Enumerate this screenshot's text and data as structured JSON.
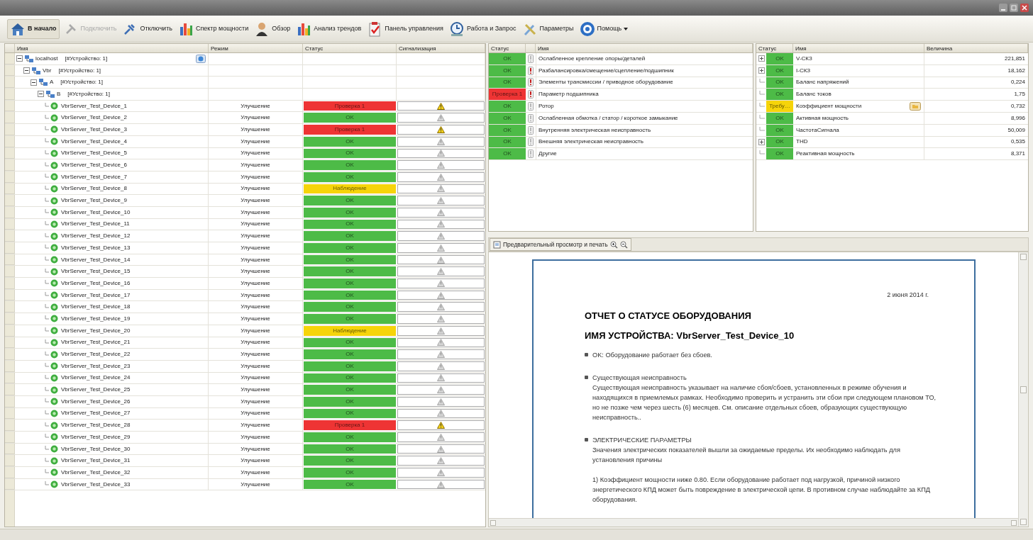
{
  "toolbar": [
    {
      "label": "В начало",
      "disabled": false,
      "kind": "button",
      "bold": true
    },
    {
      "label": "Подключить",
      "disabled": true,
      "kind": "button",
      "bold": false
    },
    {
      "label": "Отключить",
      "disabled": false,
      "kind": "button",
      "bold": false
    },
    {
      "label": "Спектр мощности",
      "disabled": false,
      "kind": "button",
      "bold": false
    },
    {
      "label": "Обзор",
      "disabled": false,
      "kind": "button",
      "bold": false
    },
    {
      "label": "Анализ трендов",
      "disabled": false,
      "kind": "button",
      "bold": false
    },
    {
      "label": "Панель управления",
      "disabled": false,
      "kind": "button",
      "bold": false
    },
    {
      "label": "Работа и Запрос",
      "disabled": false,
      "kind": "button",
      "bold": false
    },
    {
      "label": "Параметры",
      "disabled": false,
      "kind": "button",
      "bold": false
    },
    {
      "label": "Помощь",
      "disabled": false,
      "kind": "menu",
      "bold": false
    }
  ],
  "device_tree": {
    "columns": [
      "Имя",
      "Режим",
      "Статус",
      "Сигнализация"
    ],
    "nodes": [
      {
        "name": "localhost",
        "count": "[#Устройство: 1]",
        "expanded": true,
        "children": [
          {
            "name": "Vbr",
            "count": "[#Устройство: 1]",
            "expanded": true,
            "children": [
              {
                "name": "A",
                "count": "[#Устройство: 1]",
                "expanded": true,
                "children": [
                  {
                    "name": "B",
                    "count": "[#Устройство: 1]",
                    "expanded": true,
                    "children": [
                      {
                        "name": "VbrServer_Test_Device_1",
                        "mode": "Улучшение",
                        "status": "Проверка 1",
                        "color": "#ee3434",
                        "alarm": true
                      },
                      {
                        "name": "VbrServer_Test_Device_2",
                        "mode": "Улучшение",
                        "status": "OK",
                        "color": "#4dbb47",
                        "alarm": false
                      },
                      {
                        "name": "VbrServer_Test_Device_3",
                        "mode": "Улучшение",
                        "status": "Проверка 1",
                        "color": "#ee3434",
                        "alarm": true
                      },
                      {
                        "name": "VbrServer_Test_Device_4",
                        "mode": "Улучшение",
                        "status": "OK",
                        "color": "#4dbb47",
                        "alarm": false
                      },
                      {
                        "name": "VbrServer_Test_Device_5",
                        "mode": "Улучшение",
                        "status": "OK",
                        "color": "#4dbb47",
                        "alarm": false
                      },
                      {
                        "name": "VbrServer_Test_Device_6",
                        "mode": "Улучшение",
                        "status": "OK",
                        "color": "#4dbb47",
                        "alarm": false
                      },
                      {
                        "name": "VbrServer_Test_Device_7",
                        "mode": "Улучшение",
                        "status": "OK",
                        "color": "#4dbb47",
                        "alarm": false
                      },
                      {
                        "name": "VbrServer_Test_Device_8",
                        "mode": "Улучшение",
                        "status": "Наблюдение",
                        "color": "#f6d40a",
                        "alarm": false
                      },
                      {
                        "name": "VbrServer_Test_Device_9",
                        "mode": "Улучшение",
                        "status": "OK",
                        "color": "#4dbb47",
                        "alarm": false
                      },
                      {
                        "name": "VbrServer_Test_Device_10",
                        "mode": "Улучшение",
                        "status": "OK",
                        "color": "#4dbb47",
                        "alarm": false
                      },
                      {
                        "name": "VbrServer_Test_Device_11",
                        "mode": "Улучшение",
                        "status": "OK",
                        "color": "#4dbb47",
                        "alarm": false
                      },
                      {
                        "name": "VbrServer_Test_Device_12",
                        "mode": "Улучшение",
                        "status": "OK",
                        "color": "#4dbb47",
                        "alarm": false
                      },
                      {
                        "name": "VbrServer_Test_Device_13",
                        "mode": "Улучшение",
                        "status": "OK",
                        "color": "#4dbb47",
                        "alarm": false
                      },
                      {
                        "name": "VbrServer_Test_Device_14",
                        "mode": "Улучшение",
                        "status": "OK",
                        "color": "#4dbb47",
                        "alarm": false
                      },
                      {
                        "name": "VbrServer_Test_Device_15",
                        "mode": "Улучшение",
                        "status": "OK",
                        "color": "#4dbb47",
                        "alarm": false
                      },
                      {
                        "name": "VbrServer_Test_Device_16",
                        "mode": "Улучшение",
                        "status": "OK",
                        "color": "#4dbb47",
                        "alarm": false
                      },
                      {
                        "name": "VbrServer_Test_Device_17",
                        "mode": "Улучшение",
                        "status": "OK",
                        "color": "#4dbb47",
                        "alarm": false
                      },
                      {
                        "name": "VbrServer_Test_Device_18",
                        "mode": "Улучшение",
                        "status": "OK",
                        "color": "#4dbb47",
                        "alarm": false
                      },
                      {
                        "name": "VbrServer_Test_Device_19",
                        "mode": "Улучшение",
                        "status": "OK",
                        "color": "#4dbb47",
                        "alarm": false
                      },
                      {
                        "name": "VbrServer_Test_Device_20",
                        "mode": "Улучшение",
                        "status": "Наблюдение",
                        "color": "#f6d40a",
                        "alarm": false
                      },
                      {
                        "name": "VbrServer_Test_Device_21",
                        "mode": "Улучшение",
                        "status": "OK",
                        "color": "#4dbb47",
                        "alarm": false
                      },
                      {
                        "name": "VbrServer_Test_Device_22",
                        "mode": "Улучшение",
                        "status": "OK",
                        "color": "#4dbb47",
                        "alarm": false
                      },
                      {
                        "name": "VbrServer_Test_Device_23",
                        "mode": "Улучшение",
                        "status": "OK",
                        "color": "#4dbb47",
                        "alarm": false
                      },
                      {
                        "name": "VbrServer_Test_Device_24",
                        "mode": "Улучшение",
                        "status": "OK",
                        "color": "#4dbb47",
                        "alarm": false
                      },
                      {
                        "name": "VbrServer_Test_Device_25",
                        "mode": "Улучшение",
                        "status": "OK",
                        "color": "#4dbb47",
                        "alarm": false
                      },
                      {
                        "name": "VbrServer_Test_Device_26",
                        "mode": "Улучшение",
                        "status": "OK",
                        "color": "#4dbb47",
                        "alarm": false
                      },
                      {
                        "name": "VbrServer_Test_Device_27",
                        "mode": "Улучшение",
                        "status": "OK",
                        "color": "#4dbb47",
                        "alarm": false
                      },
                      {
                        "name": "VbrServer_Test_Device_28",
                        "mode": "Улучшение",
                        "status": "Проверка 1",
                        "color": "#ee3434",
                        "alarm": true
                      },
                      {
                        "name": "VbrServer_Test_Device_29",
                        "mode": "Улучшение",
                        "status": "OK",
                        "color": "#4dbb47",
                        "alarm": false
                      },
                      {
                        "name": "VbrServer_Test_Device_30",
                        "mode": "Улучшение",
                        "status": "OK",
                        "color": "#4dbb47",
                        "alarm": false
                      },
                      {
                        "name": "VbrServer_Test_Device_31",
                        "mode": "Улучшение",
                        "status": "OK",
                        "color": "#4dbb47",
                        "alarm": false
                      },
                      {
                        "name": "VbrServer_Test_Device_32",
                        "mode": "Улучшение",
                        "status": "OK",
                        "color": "#4dbb47",
                        "alarm": false
                      },
                      {
                        "name": "VbrServer_Test_Device_33",
                        "mode": "Улучшение",
                        "status": "OK",
                        "color": "#4dbb47",
                        "alarm": false
                      }
                    ]
                  }
                ]
              }
            ]
          }
        ]
      }
    ]
  },
  "fault_table": {
    "columns": [
      "Статус",
      "Имя"
    ],
    "rows": [
      {
        "status": "OK",
        "color": "#4dbb47",
        "severe": false,
        "name": "Ослабленное крепление опоры/деталей"
      },
      {
        "status": "OK",
        "color": "#4dbb47",
        "severe": true,
        "name": "Разбалансировка/смещение/сцепление/подшипник"
      },
      {
        "status": "OK",
        "color": "#4dbb47",
        "severe": true,
        "name": "Элементы трансмиссии / приводное оборудование"
      },
      {
        "status": "Проверка 1",
        "color": "#ee3434",
        "severe": true,
        "name": "Параметр подшипника"
      },
      {
        "status": "OK",
        "color": "#4dbb47",
        "severe": false,
        "name": "Ротор"
      },
      {
        "status": "OK",
        "color": "#4dbb47",
        "severe": false,
        "name": "Ослабленная обмотка / статор / короткое замыкание"
      },
      {
        "status": "OK",
        "color": "#4dbb47",
        "severe": false,
        "name": "Внутренняя электрическая неисправность"
      },
      {
        "status": "OK",
        "color": "#4dbb47",
        "severe": false,
        "name": "Внешняя электрическая неисправность"
      },
      {
        "status": "OK",
        "color": "#4dbb47",
        "severe": false,
        "name": "Другие"
      }
    ]
  },
  "parameter_table": {
    "columns": [
      "Статус",
      "Имя",
      "Величина"
    ],
    "rows": [
      {
        "status": "OK",
        "color": "#4dbb47",
        "name": "V-СКЗ",
        "value": "221,851",
        "expandable": true,
        "attachment": false
      },
      {
        "status": "OK",
        "color": "#4dbb47",
        "name": "I-СКЗ",
        "value": "18,162",
        "expandable": true,
        "attachment": false
      },
      {
        "status": "OK",
        "color": "#4dbb47",
        "name": "Баланс напряжений",
        "value": "0,224",
        "expandable": false,
        "attachment": false
      },
      {
        "status": "OK",
        "color": "#4dbb47",
        "name": "Баланс токов",
        "value": "1,75",
        "expandable": false,
        "attachment": false
      },
      {
        "status": "Требу…",
        "color": "#f6d40a",
        "name": "Коэффициент мощности",
        "value": "0,732",
        "expandable": false,
        "attachment": true
      },
      {
        "status": "OK",
        "color": "#4dbb47",
        "name": "Активная мощность",
        "value": "8,996",
        "expandable": false,
        "attachment": false
      },
      {
        "status": "OK",
        "color": "#4dbb47",
        "name": "ЧастотаСигнала",
        "value": "50,009",
        "expandable": false,
        "attachment": false
      },
      {
        "status": "OK",
        "color": "#4dbb47",
        "name": "THD",
        "value": "0,535",
        "expandable": true,
        "attachment": false
      },
      {
        "status": "OK",
        "color": "#4dbb47",
        "name": "Реактивная мощность",
        "value": "8,371",
        "expandable": false,
        "attachment": false
      }
    ]
  },
  "preview": {
    "toolbar_label": "Предварительный просмотр и печать",
    "report": {
      "date": "2 июня 2014 г.",
      "title": "ОТЧЕТ О СТАТУСЕ ОБОРУДОВАНИЯ",
      "device": "ИМЯ УСТРОЙСТВА: VbrServer_Test_Device_10",
      "sections": [
        {
          "heading": "OK: Оборудование работает без сбоев."
        },
        {
          "heading": "Существующая неисправность",
          "paragraphs": [
            "Существующая неисправность указывает на наличие сбоя/сбоев, установленных в режиме обучения и находящихся в приемлемых рамках. Необходимо проверить и устранить эти сбои при следующем плановом ТО, но не позже чем через шесть (6) месяцев. См. описание отдельных сбоев, образующих существующую неисправность.."
          ]
        },
        {
          "heading": "ЭЛЕКТРИЧЕСКИЕ ПАРАМЕТРЫ",
          "paragraphs": [
            "Значения электрических показателей вышли за ожидаемые пределы. Их необходимо наблюдать для установления причины",
            "1) Коэффициент мощности ниже 0.80. Если оборудование работает под нагрузкой, причиной низкого энергетического КПД может быть повреждение в электрической цепи. В противном случае наблюдайте за КПД оборудования."
          ]
        }
      ]
    }
  }
}
